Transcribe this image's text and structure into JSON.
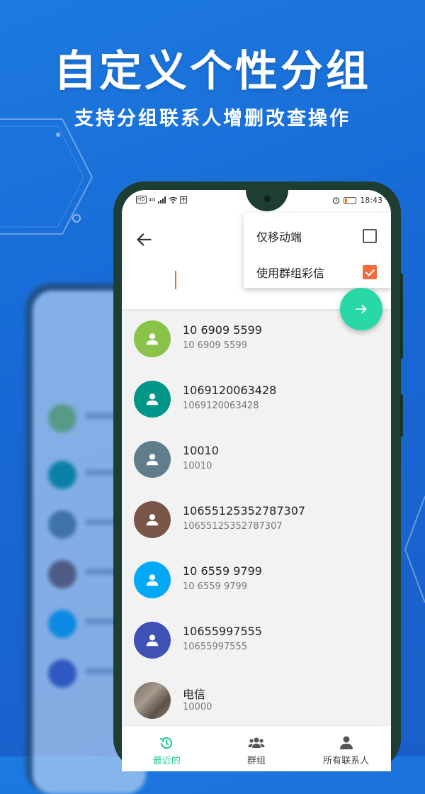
{
  "promo": {
    "headline": "自定义个性分组",
    "subheadline": "支持分组联系人增删改查操作"
  },
  "status_bar": {
    "left_badges": [
      "HD",
      "4G"
    ],
    "time": "18:43"
  },
  "menu": {
    "items": [
      {
        "label": "仅移动端",
        "checked": false
      },
      {
        "label": "使用群组彩信",
        "checked": true
      }
    ]
  },
  "contacts": [
    {
      "name": "10 6909 5599",
      "number": "10 6909 5599",
      "avatar_color": "#8bc34a"
    },
    {
      "name": "1069120063428",
      "number": "1069120063428",
      "avatar_color": "#009688"
    },
    {
      "name": "10010",
      "number": "10010",
      "avatar_color": "#607d8b"
    },
    {
      "name": "10655125352787307",
      "number": "10655125352787307",
      "avatar_color": "#795548"
    },
    {
      "name": "10 6559 9799",
      "number": "10 6559 9799",
      "avatar_color": "#03a9f4"
    },
    {
      "name": "10655997555",
      "number": "10655997555",
      "avatar_color": "#3f51b5"
    },
    {
      "name": "电信",
      "number": "10000",
      "avatar_color": "photo"
    }
  ],
  "bottom_nav": [
    {
      "label": "最近的",
      "icon": "history-icon",
      "active": true
    },
    {
      "label": "群组",
      "icon": "group-icon",
      "active": false
    },
    {
      "label": "所有联系人",
      "icon": "person-icon",
      "active": false
    }
  ],
  "colors": {
    "accent": "#28d9a7",
    "checkbox_checked": "#f26d3d",
    "cursor": "#e8692f",
    "background": "#1768d4"
  }
}
